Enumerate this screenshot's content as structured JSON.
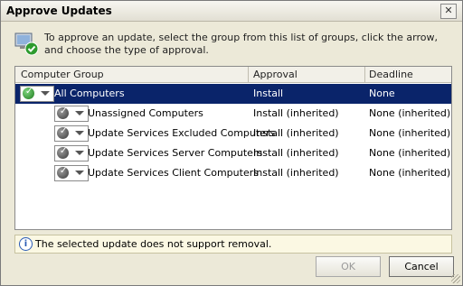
{
  "window": {
    "title": "Approve Updates",
    "close_glyph": "✕"
  },
  "header": {
    "icon": "computer-approve-icon",
    "text": "To approve an update, select the group from this list of groups, click the arrow, and choose the type of approval."
  },
  "table": {
    "columns": [
      "Computer Group",
      "Approval",
      "Deadline"
    ],
    "rows": [
      {
        "group": "All Computers",
        "approval": "Install",
        "deadline": "None",
        "selected": true
      },
      {
        "group": "Unassigned Computers",
        "approval": "Install (inherited)",
        "deadline": "None (inherited)",
        "selected": false
      },
      {
        "group": "Update Services Excluded Computers",
        "approval": "Install (inherited)",
        "deadline": "None (inherited)",
        "selected": false
      },
      {
        "group": "Update Services Server Computers",
        "approval": "Install (inherited)",
        "deadline": "None (inherited)",
        "selected": false
      },
      {
        "group": "Update Services Client Computers",
        "approval": "Install (inherited)",
        "deadline": "None (inherited)",
        "selected": false
      }
    ]
  },
  "info": {
    "icon": "info-icon",
    "text": "The selected update does not support removal."
  },
  "buttons": {
    "ok": "OK",
    "cancel": "Cancel"
  },
  "colors": {
    "selection": "#0a246a",
    "approved": "#1d7a1d"
  }
}
